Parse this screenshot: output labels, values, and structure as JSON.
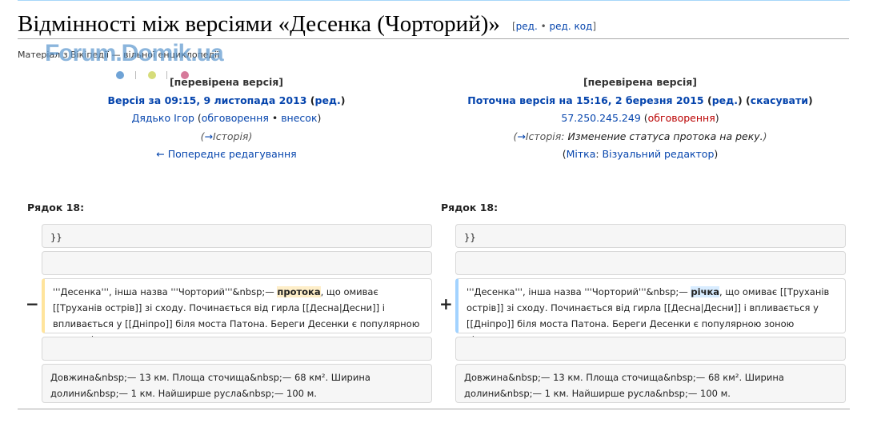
{
  "page": {
    "title": "Відмінності між версіями «Десенка (Чорторий)»",
    "edit_link": "ред.",
    "edit_source_link": "ред. код",
    "subtitle": "Матеріал з Вікіпедії — вільної енциклопедії"
  },
  "watermark": {
    "text": "Forum.Domik.ua",
    "dot_colors": [
      "#6fa3d6",
      "#d6dc7a",
      "#d67a9a"
    ]
  },
  "left": {
    "checked": "[перевірена версія]",
    "version_label": "Версія за 09:15, 9 листопада 2013",
    "version_edit": "ред.",
    "user": "Дядько Ігор",
    "talk": "обговорення",
    "contribs": "внесок",
    "history": "Історія",
    "prev_edit": "← Попереднє редагування"
  },
  "right": {
    "checked": "[перевірена версія]",
    "version_label": "Поточна версія на 15:16, 2 березня 2015",
    "version_edit": "ред.",
    "undo": "скасувати",
    "user": "57.250.245.249",
    "talk": "обговорення",
    "history": "Історія:",
    "comment": "Изменение статуса протока на реку.",
    "tag_label": "Мітка",
    "tag_value": "Візуальний редактор"
  },
  "diff": {
    "line_left": "Рядок 18:",
    "line_right": "Рядок 18:",
    "context_1": "}}",
    "del_before": "'''Десенка''', інша назва '''Чорторий'''&nbsp;— ",
    "del_word": "протока",
    "del_after": ", що омиває [[Труханів острів]] зі сходу. Починається від гирла [[Десна|Десни]] і впливається у [[Дніпро]] біля моста Патона. Береги Десенки є популярною зоною відпочинку.",
    "add_before": "'''Десенка''', інша назва '''Чорторий'''&nbsp;— ",
    "add_word": "річка",
    "add_after": ", що омиває [[Труханів острів]] зі сходу. Починається від гирла [[Десна|Десни]] і впливається у [[Дніпро]] біля моста Патона. Береги Десенки є популярною зоною відпочинку.",
    "context_last": "Довжина&nbsp;— 13 км. Площа сточища&nbsp;— 68 км². Ширина долини&nbsp;— 1 км. Найширше русла&nbsp;— 100 м.",
    "minus": "−",
    "plus": "+"
  }
}
